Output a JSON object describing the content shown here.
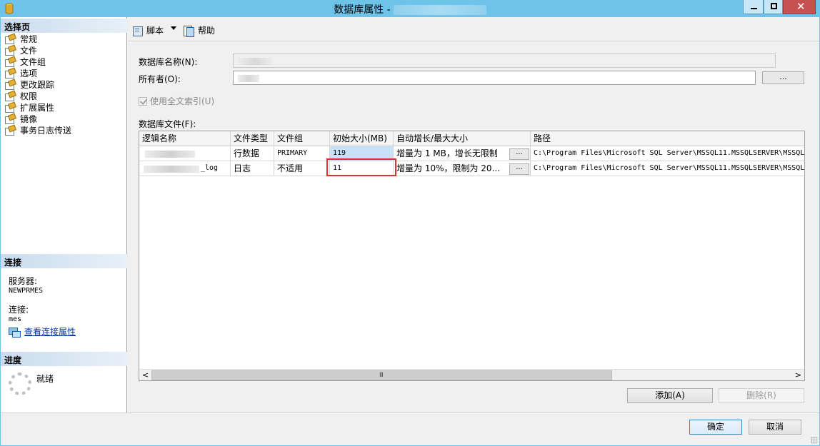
{
  "window": {
    "title": "数据库属性 -",
    "minimize": "",
    "maximize": "",
    "close": "✕"
  },
  "left_pane": {
    "pages_header": "选择页",
    "pages": [
      "常规",
      "文件",
      "文件组",
      "选项",
      "更改跟踪",
      "权限",
      "扩展属性",
      "镜像",
      "事务日志传送"
    ],
    "connection_header": "连接",
    "server_label": "服务器:",
    "server_value": "NEWPRMES",
    "connection_label": "连接:",
    "connection_value": "mes",
    "view_connection_link": "查看连接属性",
    "progress_header": "进度",
    "progress_status": "就绪"
  },
  "toolbar": {
    "script_label": "脚本",
    "help_label": "帮助"
  },
  "form": {
    "db_name_label": "数据库名称(N):",
    "owner_label": "所有者(O):",
    "owner_browse": "...",
    "fulltext_label": "使用全文索引(U)",
    "fulltext_checked": true,
    "files_label": "数据库文件(F):"
  },
  "grid": {
    "columns": [
      "逻辑名称",
      "文件类型",
      "文件组",
      "初始大小(MB)",
      "自动增长/最大大小",
      "路径"
    ],
    "rows": [
      {
        "logical_name": "",
        "file_type": "行数据",
        "filegroup": "PRIMARY",
        "initial_size": "119",
        "autogrowth": "增量为 1 MB，增长无限制",
        "path": "C:\\Program Files\\Microsoft SQL Server\\MSSQL11.MSSQLSERVER\\MSSQL"
      },
      {
        "logical_name": "_log",
        "file_type": "日志",
        "filegroup": "不适用",
        "initial_size": "11",
        "autogrowth": "增量为 10%，限制为 20...",
        "path": "C:\\Program Files\\Microsoft SQL Server\\MSSQL11.MSSQLSERVER\\MSSQL"
      }
    ],
    "browse_label": "...",
    "scroll_left": "<",
    "scroll_right": ">",
    "scroll_grip": "III"
  },
  "buttons": {
    "add": "添加(A)",
    "remove": "删除(R)",
    "ok": "确定",
    "cancel": "取消"
  }
}
